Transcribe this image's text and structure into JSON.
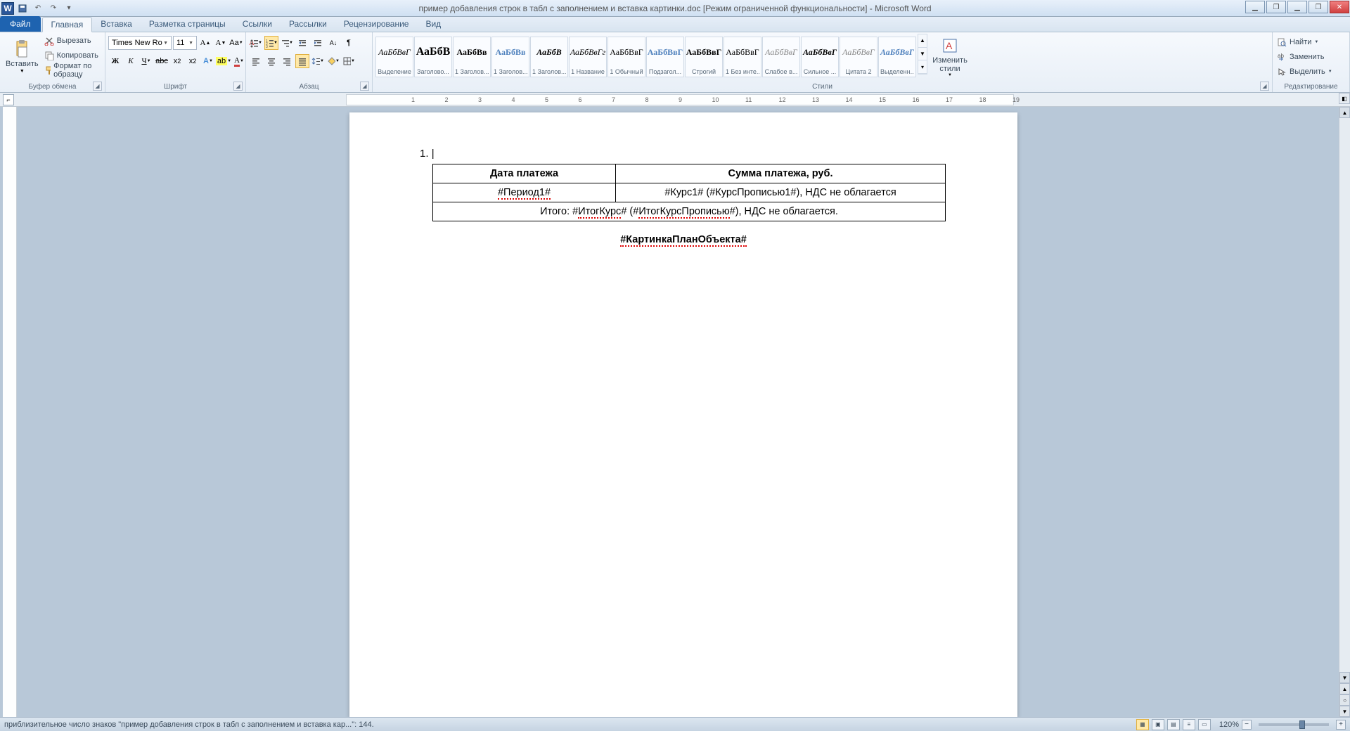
{
  "title": "пример добавления строк в табл с заполнением и вставка картинки.doc [Режим ограниченной функциональности] - Microsoft Word",
  "tabs": {
    "file": "Файл",
    "items": [
      "Главная",
      "Вставка",
      "Разметка страницы",
      "Ссылки",
      "Рассылки",
      "Рецензирование",
      "Вид"
    ],
    "active": 0
  },
  "clipboard": {
    "paste": "Вставить",
    "cut": "Вырезать",
    "copy": "Копировать",
    "format_painter": "Формат по образцу",
    "group": "Буфер обмена"
  },
  "font": {
    "name": "Times New Ro",
    "size": "11",
    "group": "Шрифт"
  },
  "paragraph": {
    "group": "Абзац"
  },
  "styles": {
    "group": "Стили",
    "change": "Изменить стили",
    "items": [
      {
        "prev": "АаБбВвГ",
        "name": "Выделение",
        "italic": true
      },
      {
        "prev": "АаБбВ",
        "name": "Заголово...",
        "bold": true,
        "large": true
      },
      {
        "prev": "АаБбВв",
        "name": "1 Заголов...",
        "bold": true
      },
      {
        "prev": "АаБбВв",
        "name": "1 Заголов...",
        "bold": true,
        "color": "#4f81bd"
      },
      {
        "prev": "АаБбВ",
        "name": "1 Заголов...",
        "bold": true,
        "italic": true
      },
      {
        "prev": "АаБбВвГг",
        "name": "1 Название",
        "italic": true
      },
      {
        "prev": "АаБбВвГ",
        "name": "1 Обычный"
      },
      {
        "prev": "АаБбВвГ",
        "name": "Подзагол...",
        "bold": true,
        "color": "#4f81bd"
      },
      {
        "prev": "АаБбВвГ",
        "name": "Строгий",
        "bold": true
      },
      {
        "prev": "АаБбВвГ",
        "name": "1 Без инте..."
      },
      {
        "prev": "АаБбВвГ",
        "name": "Слабое в...",
        "italic": true,
        "color": "#888"
      },
      {
        "prev": "АаБбВвГ",
        "name": "Сильное ...",
        "italic": true,
        "bold": true
      },
      {
        "prev": "АаБбВвГ",
        "name": "Цитата 2",
        "italic": true,
        "color": "#888"
      },
      {
        "prev": "АаБбВвГ",
        "name": "Выделенн...",
        "italic": true,
        "bold": true,
        "color": "#4f81bd"
      }
    ]
  },
  "editing": {
    "group": "Редактирование",
    "find": "Найти",
    "replace": "Заменить",
    "select": "Выделить"
  },
  "document": {
    "list_item": "1.",
    "table": {
      "headers": [
        "Дата платежа",
        "Сумма платежа, руб."
      ],
      "row": [
        "#Период1#",
        "#Курс1# (#КурсПрописью1#), НДС не облагается"
      ],
      "total_prefix": "Итого: #",
      "total_mid1": "ИтогКурс",
      "total_mid2": "# (#",
      "total_mid3": "ИтогКурсПрописью",
      "total_suffix": "#), НДС не облагается."
    },
    "image_placeholder": "#КартинкаПланОбъекта#"
  },
  "status": {
    "left": "приблизительное число знаков \"пример добавления строк в табл с заполнением и вставка кар...\": 144.",
    "zoom": "120%"
  }
}
